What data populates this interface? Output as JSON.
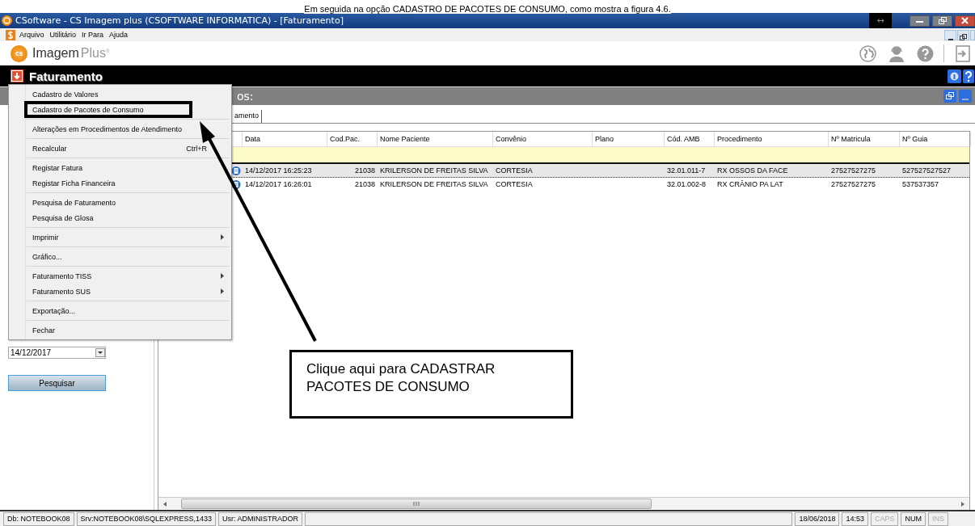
{
  "document_caption": "Em seguida na opção CADASTRO DE PACOTES DE CONSUMO, como mostra a figura 4.6.",
  "window": {
    "title": "CSoftware - CS Imagem plus (CSOFTWARE INFORMATICA) - [Faturamento]",
    "resize_hint": "↔"
  },
  "menu_bar": [
    "Arquivo",
    "Utilitário",
    "Ir Para",
    "Ajuda"
  ],
  "logo": {
    "name": "Imagem",
    "suffix": "Plus",
    "mark": "®",
    "badge": "cs"
  },
  "module": {
    "title": "Faturamento"
  },
  "panel": {
    "title": "os:"
  },
  "tabs": [
    {
      "label": "amento",
      "selected": true
    }
  ],
  "table": {
    "columns": [
      "Data",
      "Cod.Pac.",
      "Nome Paciente",
      "Convênio",
      "Plano",
      "Cód. AMB",
      "Procedimento",
      "Nº Matricula",
      "Nº Guia"
    ],
    "rows": [
      {
        "selected": true,
        "cells": [
          "14/12/2017 16:25:23",
          "21038",
          "KRILERSON DE FREITAS SILVA",
          "CORTESIA",
          "",
          "32.01.011-7",
          "RX OSSOS DA FACE",
          "27527527275",
          "527527527527"
        ]
      },
      {
        "selected": false,
        "cells": [
          "14/12/2017 16:26:01",
          "21038",
          "KRILERSON DE FREITAS SILVA",
          "CORTESIA",
          "",
          "32.01.002-8",
          "RX CRÂNIO PA LAT",
          "27527527275",
          "537537357"
        ]
      }
    ]
  },
  "sidebar": {
    "date": "14/12/2017",
    "search_button": "Pesquisar"
  },
  "popup_menu": [
    [
      {
        "label": "Cadastro de Valores",
        "submenu": false,
        "highlighted": false
      },
      {
        "label": "Cadastro de Pacotes de Consumo",
        "submenu": false,
        "highlighted": true
      }
    ],
    [
      {
        "label": "Alterações em Procedimentos de Atendimento",
        "submenu": false,
        "highlighted": false
      }
    ],
    [
      {
        "label": "Recalcular",
        "shortcut": "Ctrl+R",
        "submenu": false,
        "highlighted": false
      }
    ],
    [
      {
        "label": "Registar Fatura",
        "submenu": false,
        "highlighted": false
      },
      {
        "label": "Registar Ficha Financeira",
        "submenu": false,
        "highlighted": false
      }
    ],
    [
      {
        "label": "Pesquisa de Faturamento",
        "submenu": false,
        "highlighted": false
      },
      {
        "label": "Pesquisa de Glosa",
        "submenu": false,
        "highlighted": false
      }
    ],
    [
      {
        "label": "Imprimir",
        "submenu": true,
        "highlighted": false
      }
    ],
    [
      {
        "label": "Gráfico...",
        "submenu": false,
        "highlighted": false
      }
    ],
    [
      {
        "label": "Faturamento TISS",
        "submenu": true,
        "highlighted": false
      },
      {
        "label": "Faturamento SUS",
        "submenu": true,
        "highlighted": false
      }
    ],
    [
      {
        "label": "Exportação...",
        "submenu": false,
        "highlighted": false
      }
    ],
    [
      {
        "label": "Fechar",
        "submenu": false,
        "highlighted": false
      }
    ]
  ],
  "callout": {
    "text": "Clique aqui para CADASTRAR PACOTES DE CONSUMO"
  },
  "status_bar": [
    {
      "text": "Db: NOTEBOOK08",
      "enabled": true
    },
    {
      "text": "Srv:NOTEBOOK08\\SQLEXPRESS,1433",
      "enabled": true
    },
    {
      "text": "Usr: ADMINISTRADOR",
      "enabled": true
    },
    {
      "text": "18/06/2018",
      "enabled": true
    },
    {
      "text": "14:53",
      "enabled": true
    },
    {
      "text": "CAPS",
      "enabled": false
    },
    {
      "text": "NUM",
      "enabled": true
    },
    {
      "text": "INS",
      "enabled": false
    }
  ]
}
